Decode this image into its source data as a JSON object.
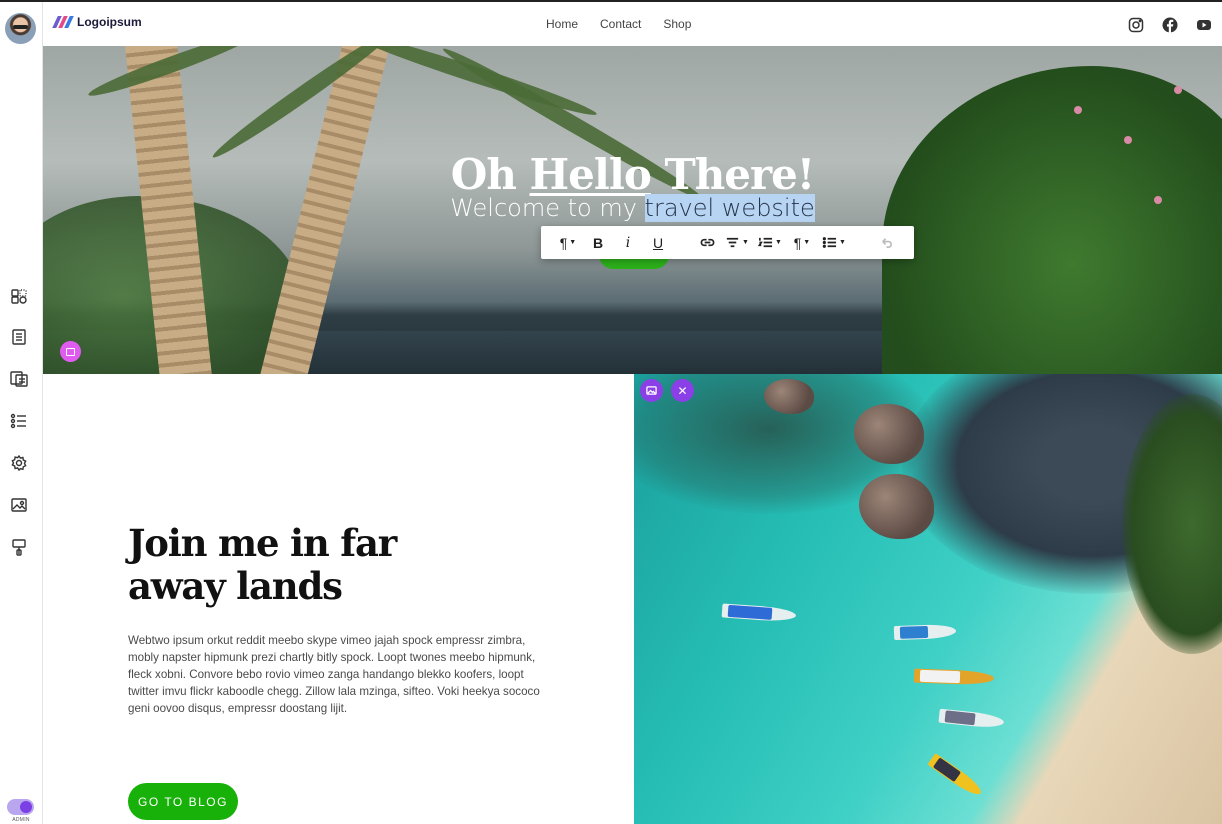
{
  "brand": {
    "name": "Logoipsum",
    "mark_colors": [
      "#6d5bd0",
      "#e14b8a",
      "#3a7be3"
    ]
  },
  "nav": {
    "items": [
      "Home",
      "Contact",
      "Shop"
    ]
  },
  "social": {
    "icons": [
      "instagram-icon",
      "facebook-icon",
      "youtube-icon"
    ]
  },
  "sidebar": {
    "icons": [
      "elements-icon",
      "pages-icon",
      "blog-icon",
      "list-icon",
      "settings-icon",
      "media-icon",
      "design-icon"
    ],
    "toggle_label": "ADMIN",
    "toggle_on": true
  },
  "hero": {
    "title_pre": "Oh ",
    "title_underlined": "Hello",
    "title_post": " There!",
    "subtitle_plain": "Welcome to my ",
    "subtitle_selected": "travel website"
  },
  "toolbar": {
    "paragraph_label": "¶",
    "bold_label": "B",
    "italic_label": "i",
    "underline_label": "U",
    "clear_format_label": "¶"
  },
  "section": {
    "heading": "Join me in far away lands",
    "body": "Webtwo ipsum orkut reddit meebo skype vimeo jajah spock empressr zimbra, mobly napster hipmunk prezi chartly bitly spock. Loopt twones meebo hipmunk, fleck xobni. Convore bebo rovio vimeo zanga handango blekko koofers, loopt twitter imvu flickr kaboodle chegg. Zillow lala mzinga, sifteo. Voki heekya sococo geni oovoo disqus, empressr doostang lijit.",
    "cta_label": "GO TO BLOG"
  },
  "image_controls": {
    "replace_icon": "image-icon",
    "remove_icon": "close-icon"
  },
  "colors": {
    "accent_purple": "#8b3fe7",
    "accent_pink": "#e05cf1",
    "cta_green": "#18b10a",
    "selection": "#b8d4f3"
  }
}
